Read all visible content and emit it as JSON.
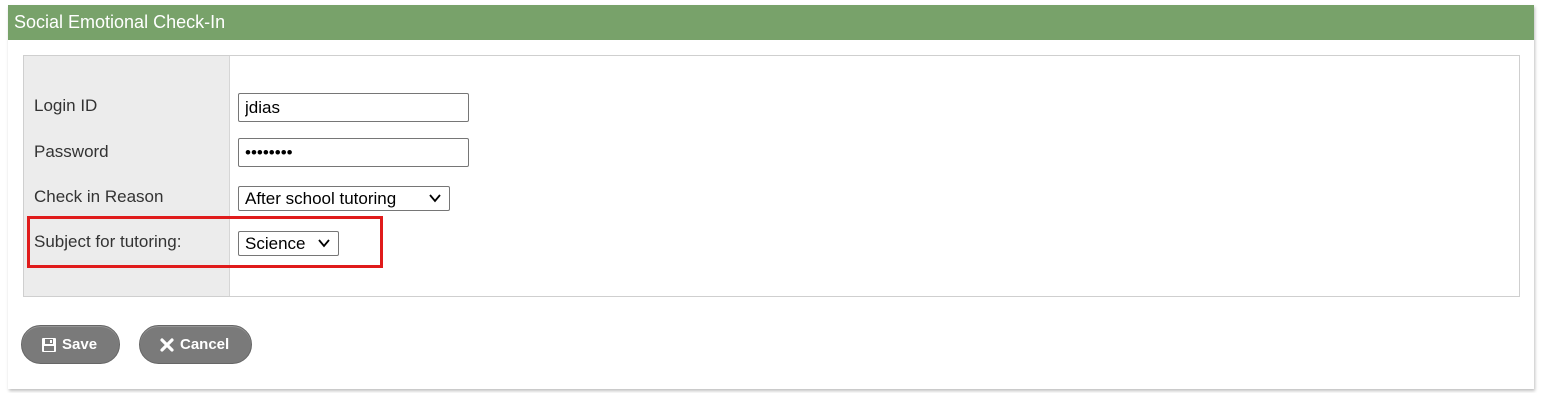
{
  "panel": {
    "title": "Social Emotional Check-In",
    "header_color": "#78a26a"
  },
  "form": {
    "login_id": {
      "label": "Login ID",
      "value": "jdias"
    },
    "password": {
      "label": "Password",
      "value": "••••••••"
    },
    "check_in_reason": {
      "label": "Check in Reason",
      "selected": "After school tutoring"
    },
    "subject": {
      "label": "Subject for tutoring:",
      "selected": "Science"
    },
    "highlight_color": "#e01b1b"
  },
  "buttons": {
    "save_label": "Save",
    "cancel_label": "Cancel",
    "save_icon": "floppy-disk-icon",
    "cancel_icon": "x-icon"
  }
}
